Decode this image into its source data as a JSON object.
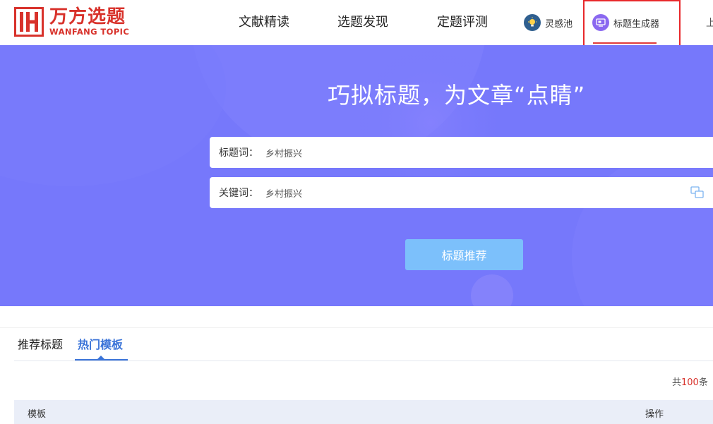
{
  "brand": {
    "name_cn": "万方选题",
    "name_en": "WANFANG TOPIC"
  },
  "nav": {
    "items": [
      {
        "label": "文献精读"
      },
      {
        "label": "选题发现"
      },
      {
        "label": "定题评测"
      }
    ],
    "inspiration_label": "灵感池",
    "title_generator_label": "标题生成器",
    "clipped_label": "上"
  },
  "hero": {
    "headline": "巧拟标题，为文章“点睛”",
    "title_field": {
      "label": "标题词：",
      "value": "乡村振兴"
    },
    "keyword_field": {
      "label": "关键词：",
      "value": "乡村振兴"
    },
    "button_label": "标题推荐"
  },
  "tabs": [
    {
      "label": "推荐标题",
      "active": false
    },
    {
      "label": "热门模板",
      "active": true
    }
  ],
  "results": {
    "total_prefix": "共",
    "total_count": "100",
    "total_suffix": "条"
  },
  "table": {
    "columns": [
      "模板",
      "操作"
    ]
  },
  "colors": {
    "brand_red": "#d8322b",
    "hero_bg": "#7678fb",
    "accent_blue": "#3b74d8",
    "button": "#7cc0fb"
  }
}
